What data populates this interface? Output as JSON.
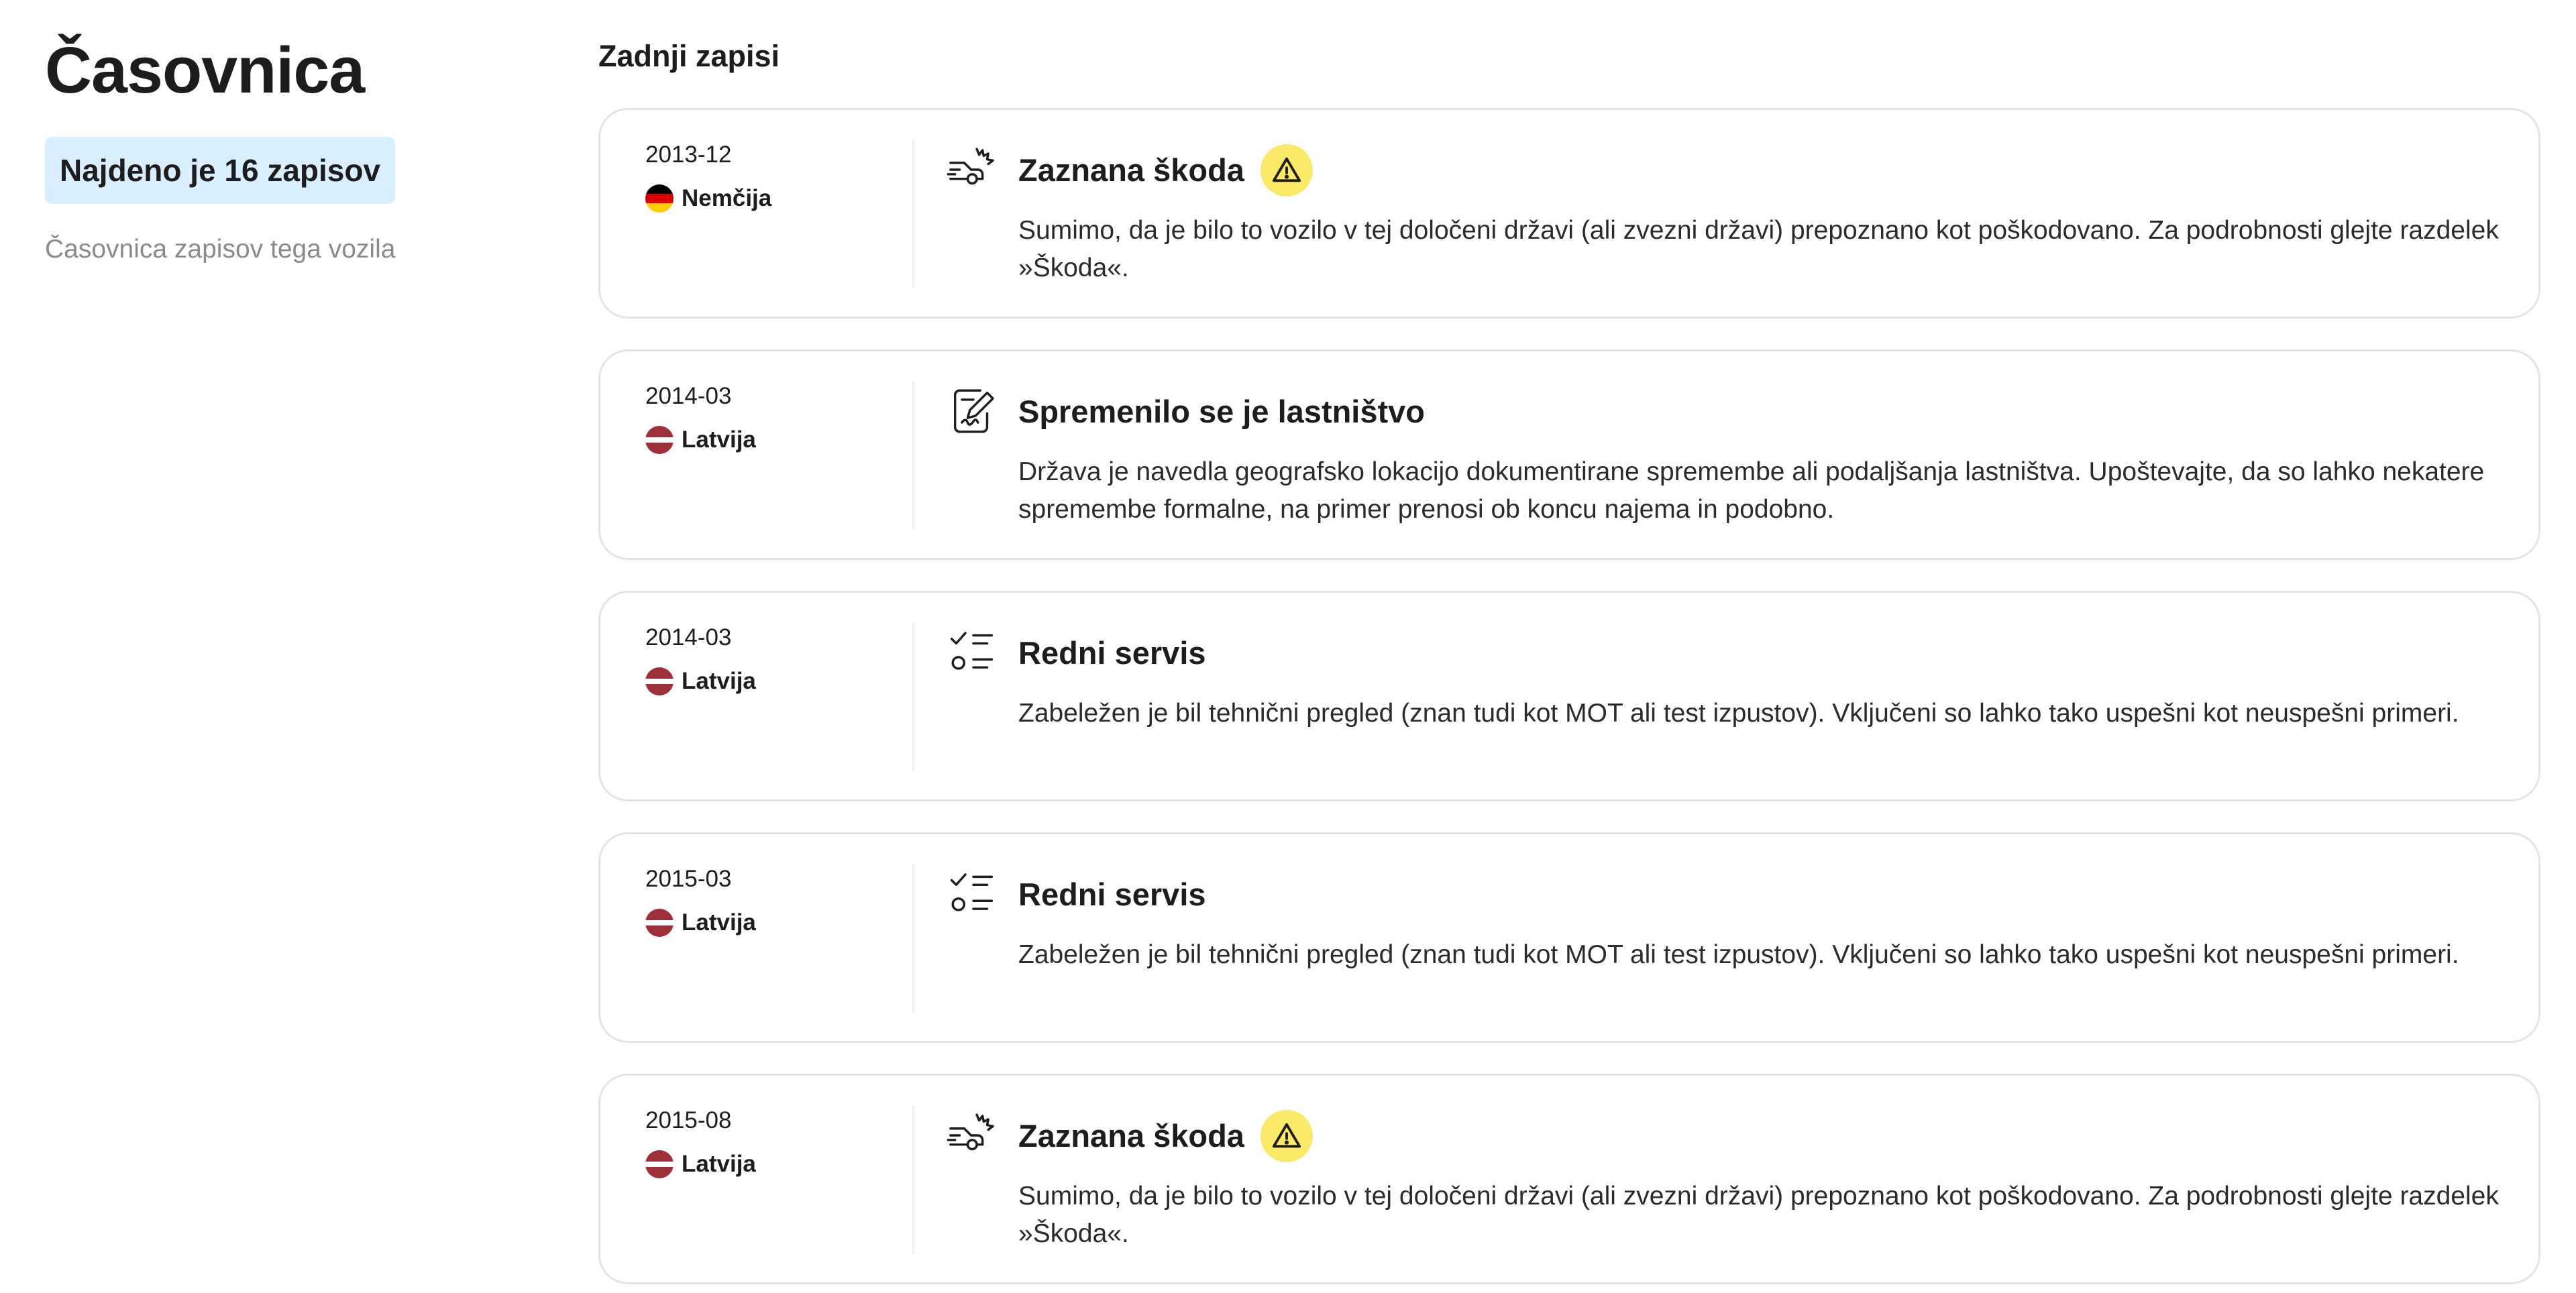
{
  "sidebar": {
    "title": "Časovnica",
    "count_badge": "Najdeno je 16 zapisov",
    "subtitle": "Časovnica zapisov tega vozila"
  },
  "main": {
    "heading": "Zadnji zapisi",
    "records": [
      {
        "date": "2013-12",
        "country": "Nemčija",
        "flag": "germany-flag",
        "icon": "car-crash-icon",
        "title": "Zaznana škoda",
        "warning": true,
        "description": "Sumimo, da je bilo to vozilo v tej določeni državi (ali zvezni državi) prepoznano kot poškodovano. Za podrobnosti glejte razdelek »Škoda«."
      },
      {
        "date": "2014-03",
        "country": "Latvija",
        "flag": "latvia-flag",
        "icon": "signed-document-icon",
        "title": "Spremenilo se je lastništvo",
        "warning": false,
        "description": "Država je navedla geografsko lokacijo dokumentirane spremembe ali podaljšanja lastništva. Upoštevajte, da so lahko nekatere spremembe formalne, na primer prenosi ob koncu najema in podobno."
      },
      {
        "date": "2014-03",
        "country": "Latvija",
        "flag": "latvia-flag",
        "icon": "checklist-icon",
        "title": "Redni servis",
        "warning": false,
        "description": "Zabeležen je bil tehnični pregled (znan tudi kot MOT ali test izpustov). Vključeni so lahko tako uspešni kot neuspešni primeri."
      },
      {
        "date": "2015-03",
        "country": "Latvija",
        "flag": "latvia-flag",
        "icon": "checklist-icon",
        "title": "Redni servis",
        "warning": false,
        "description": "Zabeležen je bil tehnični pregled (znan tudi kot MOT ali test izpustov). Vključeni so lahko tako uspešni kot neuspešni primeri."
      },
      {
        "date": "2015-08",
        "country": "Latvija",
        "flag": "latvia-flag",
        "icon": "car-crash-icon",
        "title": "Zaznana škoda",
        "warning": true,
        "description": "Sumimo, da je bilo to vozilo v tej določeni državi (ali zvezni državi) prepoznano kot poškodovano. Za podrobnosti glejte razdelek »Škoda«."
      }
    ]
  },
  "colors": {
    "badge_bg": "#d9efff",
    "warning_yellow": "#fbe968",
    "card_border": "#e4e4e7",
    "muted_text": "#8a8a8f"
  }
}
